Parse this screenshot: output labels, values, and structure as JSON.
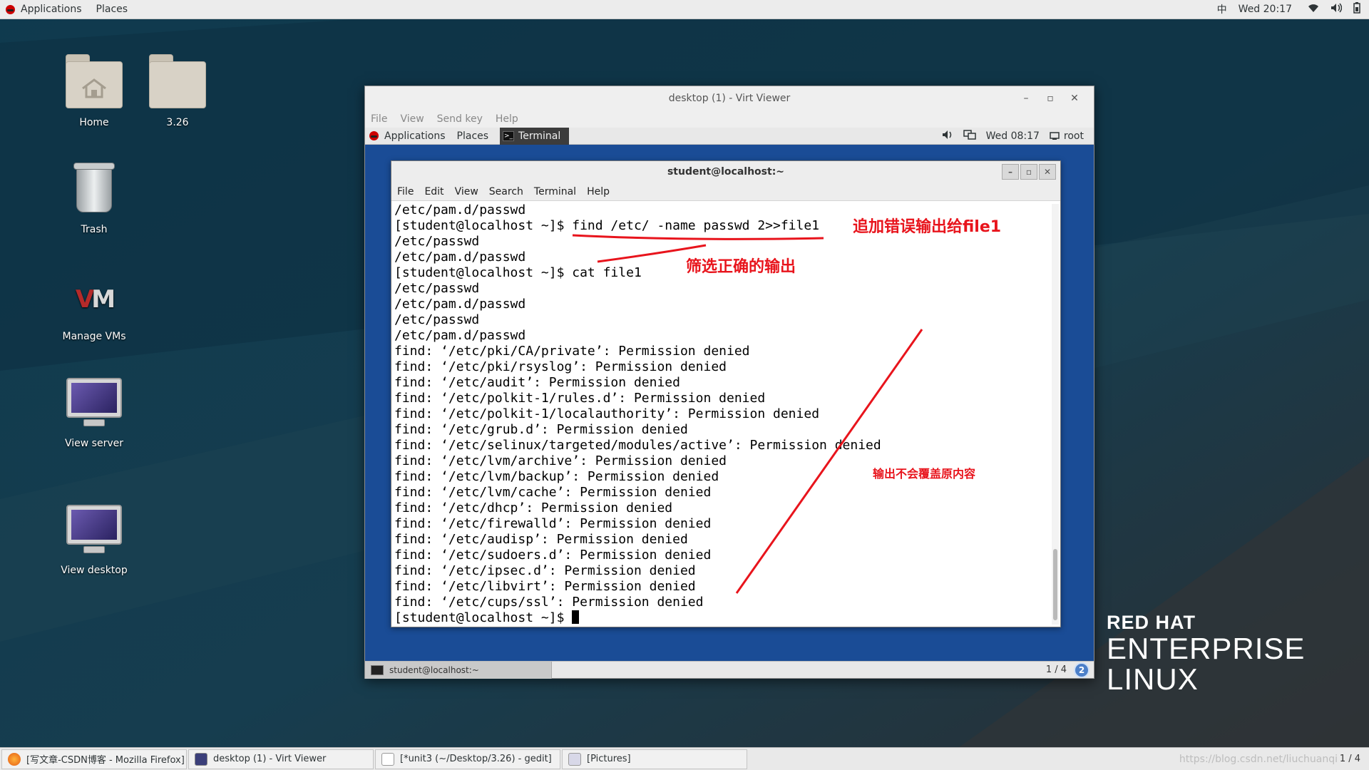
{
  "host_topbar": {
    "applications": "Applications",
    "places": "Places",
    "input_method": "中",
    "clock": "Wed 20:17"
  },
  "desktop_icons": [
    {
      "label": "Home"
    },
    {
      "label": "3.26"
    },
    {
      "label": "Trash"
    },
    {
      "label": "Manage VMs"
    },
    {
      "label": "View server"
    },
    {
      "label": "View desktop"
    }
  ],
  "virt_viewer": {
    "title": "desktop (1) - Virt Viewer",
    "menu": [
      "File",
      "View",
      "Send key",
      "Help"
    ],
    "guest_topbar": {
      "applications": "Applications",
      "places": "Places",
      "terminal_tab": "Terminal",
      "clock": "Wed 08:17",
      "user": "root"
    },
    "terminal": {
      "title": "student@localhost:~",
      "menu": [
        "File",
        "Edit",
        "View",
        "Search",
        "Terminal",
        "Help"
      ],
      "lines": [
        "/etc/pam.d/passwd",
        "[student@localhost ~]$ find /etc/ -name passwd 2>>file1",
        "/etc/passwd",
        "/etc/pam.d/passwd",
        "[student@localhost ~]$ cat file1",
        "/etc/passwd",
        "/etc/pam.d/passwd",
        "/etc/passwd",
        "/etc/pam.d/passwd",
        "find: ‘/etc/pki/CA/private’: Permission denied",
        "find: ‘/etc/pki/rsyslog’: Permission denied",
        "find: ‘/etc/audit’: Permission denied",
        "find: ‘/etc/polkit-1/rules.d’: Permission denied",
        "find: ‘/etc/polkit-1/localauthority’: Permission denied",
        "find: ‘/etc/grub.d’: Permission denied",
        "find: ‘/etc/selinux/targeted/modules/active’: Permission denied",
        "find: ‘/etc/lvm/archive’: Permission denied",
        "find: ‘/etc/lvm/backup’: Permission denied",
        "find: ‘/etc/lvm/cache’: Permission denied",
        "find: ‘/etc/dhcp’: Permission denied",
        "find: ‘/etc/firewalld’: Permission denied",
        "find: ‘/etc/audisp’: Permission denied",
        "find: ‘/etc/sudoers.d’: Permission denied",
        "find: ‘/etc/ipsec.d’: Permission denied",
        "find: ‘/etc/libvirt’: Permission denied",
        "find: ‘/etc/cups/ssl’: Permission denied",
        "[student@localhost ~]$ "
      ]
    },
    "guest_taskbar": {
      "task": "student@localhost:~",
      "workspace": "1 / 4",
      "badge": "2"
    }
  },
  "annotations": {
    "append_error": "追加错误输出给file1",
    "filter_correct": "筛选正确的输出",
    "no_overwrite": "输出不会覆盖原内容"
  },
  "branding": {
    "line1": "RED HAT",
    "line2": "ENTERPRISE",
    "line3": "LINUX"
  },
  "taskbar": {
    "items": [
      "[写文章-CSDN博客 - Mozilla Firefox]",
      "desktop (1) - Virt Viewer",
      "[*unit3 (~/Desktop/3.26) - gedit]",
      "[Pictures]"
    ],
    "watermark": "https://blog.csdn.net/liuchuanqi",
    "page": "1 / 4"
  },
  "colors": {
    "annotation": "#e8141c",
    "guest_background": "#1a4c96"
  }
}
